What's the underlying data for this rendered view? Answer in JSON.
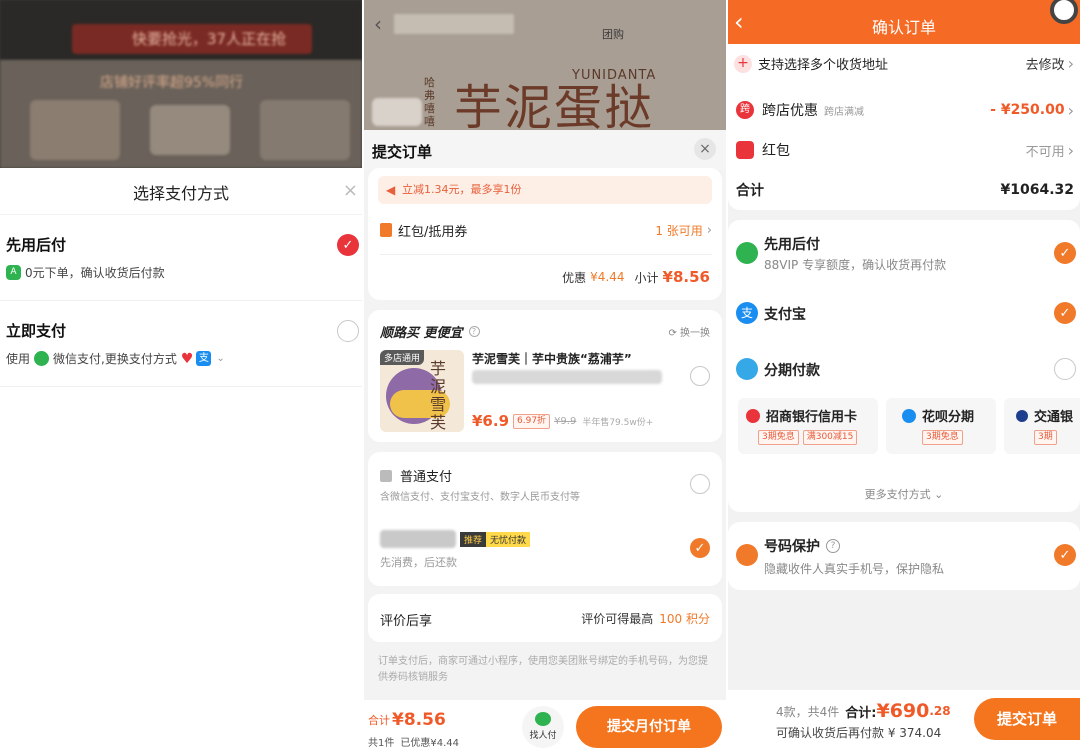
{
  "panel1": {
    "banner_text": "快要抢光，37人正在抢",
    "sub_banner": "店铺好评率超95%同行",
    "sheet_title": "选择支付方式",
    "options": [
      {
        "title": "先用后付",
        "desc": "0元下单，确认收货后付款",
        "checked": true
      },
      {
        "title": "立即支付",
        "desc_prefix": "使用",
        "desc_mid": "微信支付",
        "desc_suffix": ",更换支付方式",
        "checked": false
      }
    ]
  },
  "panel2": {
    "bg_brand": "YUNIDANTA",
    "bg_title": "芋泥蛋挞",
    "bg_side": "哈弗嘻嘻",
    "top_tab": "团购",
    "sheet_title": "提交订单",
    "promo": "立减1.34元，最多享1份",
    "coupon_label": "红包/抵用券",
    "coupon_value": "1 张可用",
    "discount_label": "优惠",
    "discount_value": "¥4.44",
    "subtotal_label": "小计",
    "subtotal_value": "¥8.56",
    "addon_title": "顺路买 更便宜",
    "addon_switch": "换一换",
    "product_badge": "多店通用",
    "product_img_text": "芋泥雪芙",
    "product_name": "芋泥雪芙｜芋中贵族“荔浦芋”",
    "product_price": "¥6.9",
    "product_discount": "6.97折",
    "product_orig": "¥9.9",
    "product_sold": "半年售79.5w份+",
    "pay_normal_title": "普通支付",
    "pay_normal_desc": "含微信支付、支付宝支付、数字人民币支付等",
    "pay_monthly_tag1": "推荐",
    "pay_monthly_tag2": "无忧付款",
    "pay_monthly_desc": "先消费，后还款",
    "review_label": "评价后享",
    "review_text": "评价可得最高",
    "review_points": "100 积分",
    "notice": "订单支付后，商家可通过小程序，使用您美团账号绑定的手机号码，为您提供券码核销服务",
    "footer_total_label": "合计",
    "footer_total": "¥8.56",
    "footer_count": "共1件",
    "footer_saved": "已优惠¥4.44",
    "friend_pay": "找人付",
    "submit": "提交月付订单"
  },
  "panel3": {
    "title": "确认订单",
    "address_label": "支持选择多个收货地址",
    "address_action": "去修改",
    "cross_store_label": "跨店优惠",
    "cross_store_sub": "跨店满减",
    "cross_store_value": "- ¥250.00",
    "redpacket_label": "红包",
    "redpacket_value": "不可用",
    "total_label": "合计",
    "total_value": "¥1064.32",
    "pay_options": [
      {
        "title": "先用后付",
        "desc": "88VIP 专享额度，确认收货再付款",
        "checked": true
      },
      {
        "title": "支付宝",
        "desc": "",
        "checked": true
      },
      {
        "title": "分期付款",
        "desc": "",
        "checked": false
      }
    ],
    "installments": [
      {
        "name": "招商银行信用卡",
        "tags": [
          "3期免息",
          "满300减15"
        ]
      },
      {
        "name": "花呗分期",
        "tags": [
          "3期免息"
        ]
      },
      {
        "name": "交通银",
        "tags": [
          "3期"
        ]
      }
    ],
    "more_methods": "更多支付方式",
    "privacy_title": "号码保护",
    "privacy_desc": "隐藏收件人真实手机号，保护隐私",
    "footer_count": "4款，共4件",
    "footer_total_label": "合计:",
    "footer_total": "¥690",
    "footer_total_dec": ".28",
    "footer_later": "可确认收货后再付款 ¥ 374.04",
    "submit": "提交订单"
  }
}
